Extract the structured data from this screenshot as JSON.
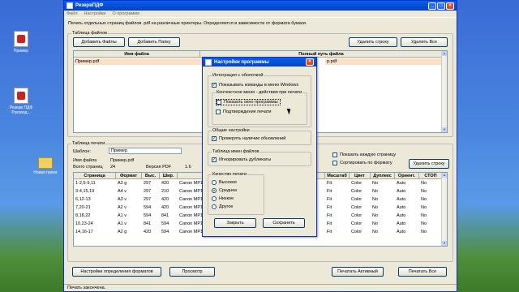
{
  "desktop": {
    "icons": [
      "Пример",
      "Резерв ПДФ Руковод...",
      "Новая папка"
    ]
  },
  "window": {
    "title": "РезервПДФ",
    "menu": [
      "Файл",
      "Настройки",
      "О программе"
    ],
    "description": "Печать отдельных страниц файлов .pdf на различные принтеры. Определяется в зависимости от формата бумаги.",
    "files_group": {
      "label": "Таблица файлов",
      "add_files": "Добавить Файлы",
      "add_folder": "Добавить Папку",
      "delete_row": "Удалить строку",
      "delete_all": "Удалить Все",
      "col_name": "Имя файла",
      "col_path": "Полный путь файла",
      "rows": [
        {
          "name": "Пример.pdf",
          "path_left": "C",
          "path_right": "р.pdf"
        }
      ]
    },
    "print_group": {
      "label": "Таблица печати",
      "template_label": "Шаблон:",
      "template_value": "Пример",
      "filename_label": "Имя файла",
      "filename_value": "Пример.pdf",
      "pages_label": "Всего страниц",
      "pages_value": "24",
      "pdf_version_label": "Версия PDF",
      "pdf_version_value": "1.6",
      "show_each_page": "Показать каждую страницу",
      "sort_by_format": "Сортировать по формату",
      "delete_row": "Удалить строку",
      "headers": [
        "Страница",
        "Формат",
        "Выс.",
        "Шир.",
        "Принтер",
        "Масштаб",
        "Цвет",
        "Дуплекс",
        "Ориент.",
        "СТОП"
      ],
      "rows": [
        [
          "1-2,5-9,11",
          "A3 g",
          "297",
          "420",
          "Canon MP160",
          "Fit",
          "Color",
          "No",
          "Auto",
          "No"
        ],
        [
          "3-4,15,19",
          "A4 v",
          "297",
          "210",
          "Canon MP160",
          "Fit",
          "Color",
          "No",
          "Auto",
          "No"
        ],
        [
          "6,12-13",
          "A3 v",
          "297",
          "420",
          "Canon MP160",
          "Fit",
          "Color",
          "No",
          "Auto",
          "No"
        ],
        [
          "7,20-21",
          "A2 v",
          "594",
          "420",
          "Canon MP160",
          "Fit",
          "Color",
          "No",
          "Auto",
          "No"
        ],
        [
          "8,18,22",
          "A1 v",
          "594",
          "841",
          "Canon MP160",
          "Fit",
          "Color",
          "No",
          "Auto",
          "No"
        ],
        [
          "10,23-24",
          "A1 v",
          "841",
          "594",
          "Canon MP160",
          "Fit",
          "Color",
          "No",
          "Auto",
          "No"
        ],
        [
          "14,16-17",
          "A2 g",
          "420",
          "594",
          "Canon MP160",
          "Fit",
          "Color",
          "No",
          "Auto",
          "No"
        ]
      ]
    },
    "bottom": {
      "format_settings": "Настройки определения форматов",
      "preview": "Просмотр",
      "print_active": "Печатать Активный",
      "print_all": "Печатать Все"
    },
    "status": "Печать закончена."
  },
  "dialog": {
    "title": "Настройки программы",
    "shell_group": "Интеграция с оболочкой",
    "show_menu_commands": "Показывать команды в меню Windows",
    "context_menu_group": "Контекстное меню - действия при печати",
    "show_program_window": "Показать окно программы",
    "print_confirm": "Подтверждение печати",
    "general_group": "Общие настройки",
    "check_updates": "Проверять наличие обновлений",
    "filenames_group": "Таблица имен файлов",
    "ignore_duplicates": "Игнорировать дубликаты",
    "quality_group": "Качество печати",
    "quality_options": [
      "Высокое",
      "Среднее",
      "Низкое",
      "Другое"
    ],
    "quality_selected": "Среднее",
    "close_button": "Закрыть",
    "save_button": "Сохранить"
  }
}
